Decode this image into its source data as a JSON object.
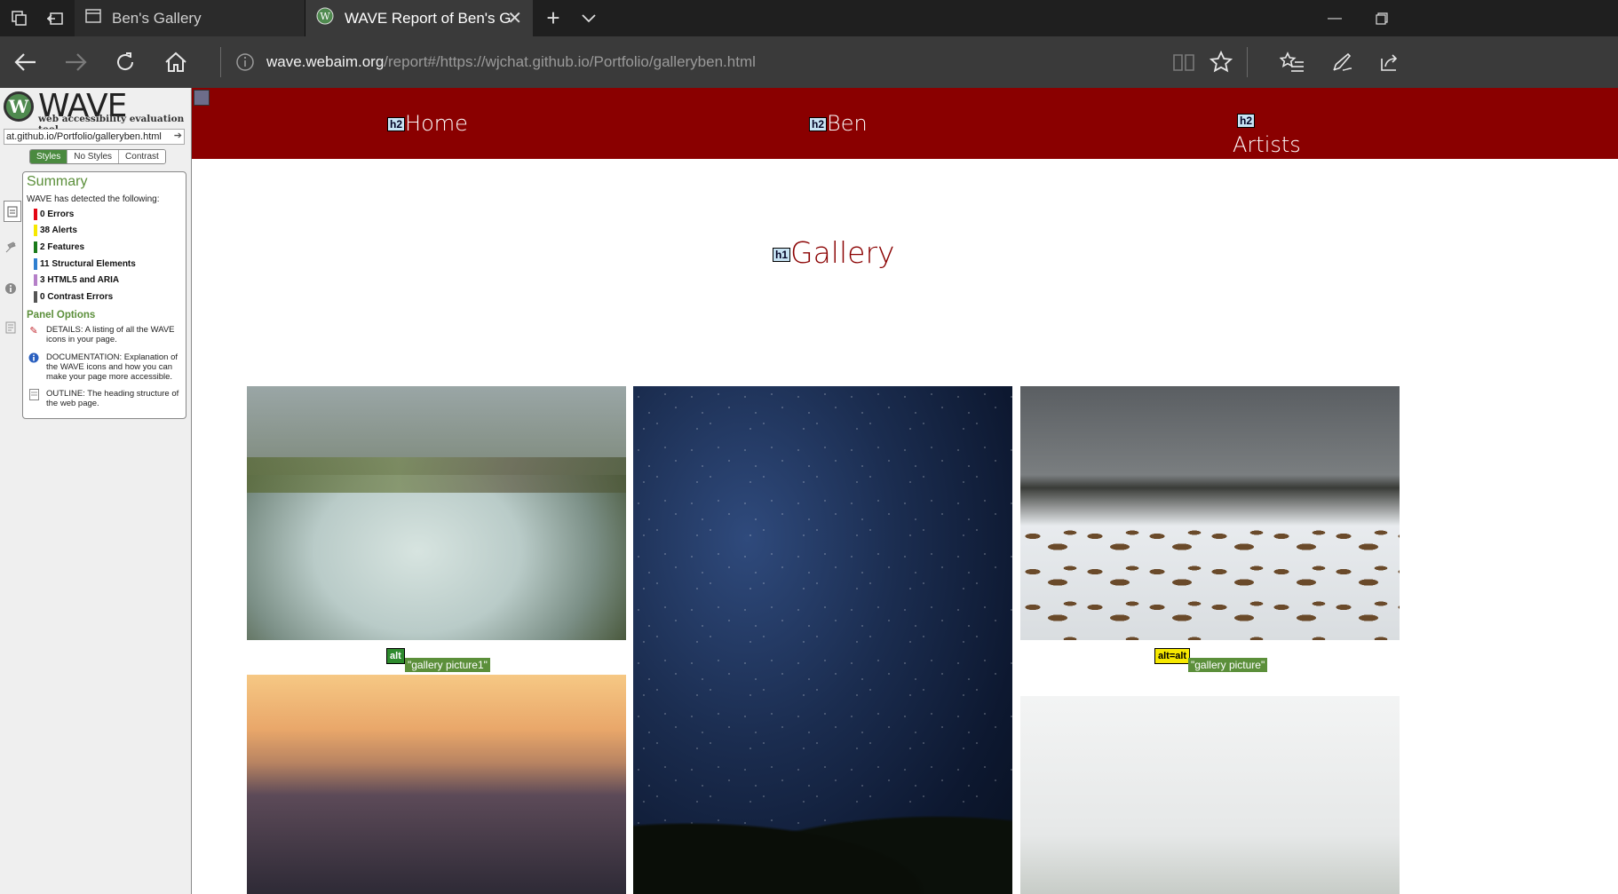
{
  "browser": {
    "tabs": [
      {
        "label": "Ben's Gallery"
      },
      {
        "label": "WAVE Report of Ben's G"
      }
    ],
    "address": {
      "host": "wave.webaim.org",
      "path": "/report#/https://wjchat.github.io/Portfolio/galleryben.html"
    }
  },
  "wave": {
    "title": "WAVE",
    "subtitle": "web accessibility evaluation tool",
    "url_value": "at.github.io/Portfolio/galleryben.html",
    "styles_buttons": [
      "Styles",
      "No Styles",
      "Contrast"
    ],
    "summary": {
      "heading": "Summary",
      "detected": "WAVE has detected the following:",
      "items": [
        {
          "label": "0 Errors",
          "color": "#e30613"
        },
        {
          "label": "38 Alerts",
          "color": "#f6e800"
        },
        {
          "label": "2 Features",
          "color": "#1a7a1a"
        },
        {
          "label": "11 Structural Elements",
          "color": "#2f7fd0"
        },
        {
          "label": "3 HTML5 and ARIA",
          "color": "#b57fc8"
        },
        {
          "label": "0 Contrast Errors",
          "color": "#555555"
        }
      ],
      "panel_options": "Panel Options",
      "options": [
        {
          "icon": "details-icon",
          "text": "DETAILS: A listing of all the WAVE icons in your page."
        },
        {
          "icon": "documentation-icon",
          "text": "DOCUMENTATION: Explanation of the WAVE icons and how you can make your page more accessible."
        },
        {
          "icon": "outline-icon",
          "text": "OUTLINE: The heading structure of the web page."
        }
      ]
    }
  },
  "site": {
    "nav": [
      {
        "badge": "h2",
        "label": "Home"
      },
      {
        "badge": "h2",
        "label": "Ben"
      },
      {
        "badge": "h2",
        "label": "Artists"
      }
    ],
    "heading_badge": "h1",
    "heading": "Gallery",
    "annotations": [
      {
        "badge": "alt",
        "text": "\"gallery picture1\""
      },
      {
        "badge": "alt=alt",
        "text": "\"gallery picture\""
      }
    ]
  },
  "colors": {
    "nav_background": "#8a0000",
    "heading_color": "#8a0000",
    "wave_accent": "#5b8f3a"
  }
}
